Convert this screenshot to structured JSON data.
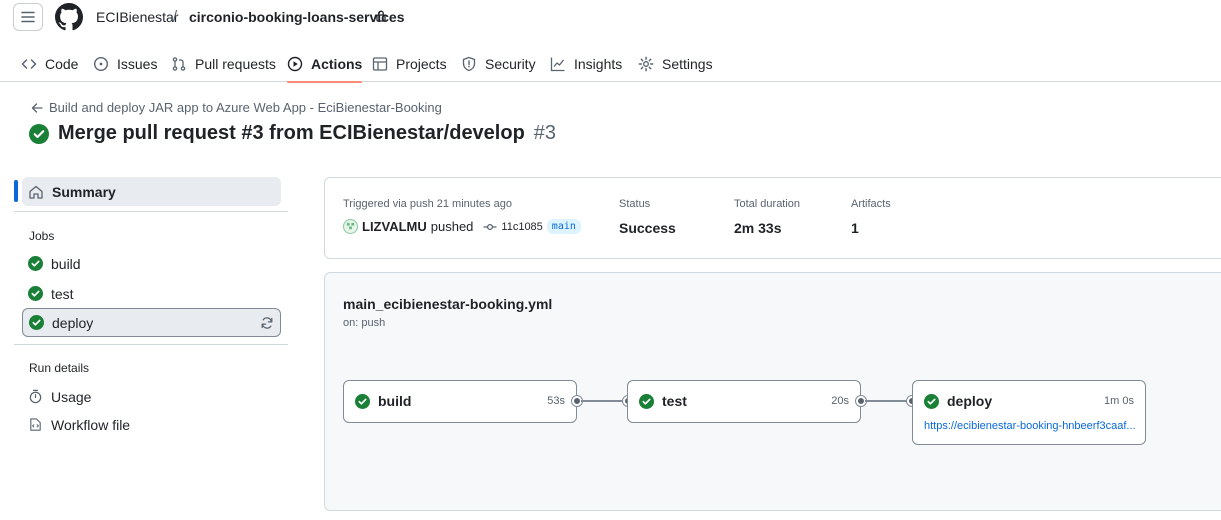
{
  "header": {
    "owner": "ECIBienestar",
    "separator": "/",
    "repo": "circonio-booking-loans-services"
  },
  "tabs": [
    {
      "label": "Code",
      "icon": "code-icon"
    },
    {
      "label": "Issues",
      "icon": "issue-opened-icon"
    },
    {
      "label": "Pull requests",
      "icon": "git-pull-request-icon"
    },
    {
      "label": "Actions",
      "icon": "play-icon",
      "active": true
    },
    {
      "label": "Projects",
      "icon": "table-icon"
    },
    {
      "label": "Security",
      "icon": "shield-icon"
    },
    {
      "label": "Insights",
      "icon": "graph-icon"
    },
    {
      "label": "Settings",
      "icon": "gear-icon"
    }
  ],
  "run": {
    "workflow_link": "Build and deploy JAR app to Azure Web App - EciBienestar-Booking",
    "title": "Merge pull request #3 from ECIBienestar/develop",
    "number": "#3"
  },
  "sidebar": {
    "summary": "Summary",
    "jobs_label": "Jobs",
    "jobs": [
      "build",
      "test",
      "deploy"
    ],
    "run_details_label": "Run details",
    "usage": "Usage",
    "workflow_file": "Workflow file"
  },
  "summary": {
    "triggered_label": "Triggered via push 21 minutes ago",
    "actor": "LIZVALMU",
    "action": "pushed",
    "commit": "11c1085",
    "branch": "main",
    "status_label": "Status",
    "status_value": "Success",
    "duration_label": "Total duration",
    "duration_value": "2m 33s",
    "artifacts_label": "Artifacts",
    "artifacts_value": "1"
  },
  "graph": {
    "file": "main_ecibienestar-booking.yml",
    "trigger": "on: push",
    "jobs": [
      {
        "name": "build",
        "duration": "53s"
      },
      {
        "name": "test",
        "duration": "20s"
      },
      {
        "name": "deploy",
        "duration": "1m 0s",
        "url": "https://ecibienestar-booking-hnbeerf3caaf..."
      }
    ]
  },
  "colors": {
    "success": "#1a7f37",
    "accent": "#0969da",
    "tab_underline": "#fd8c73"
  }
}
